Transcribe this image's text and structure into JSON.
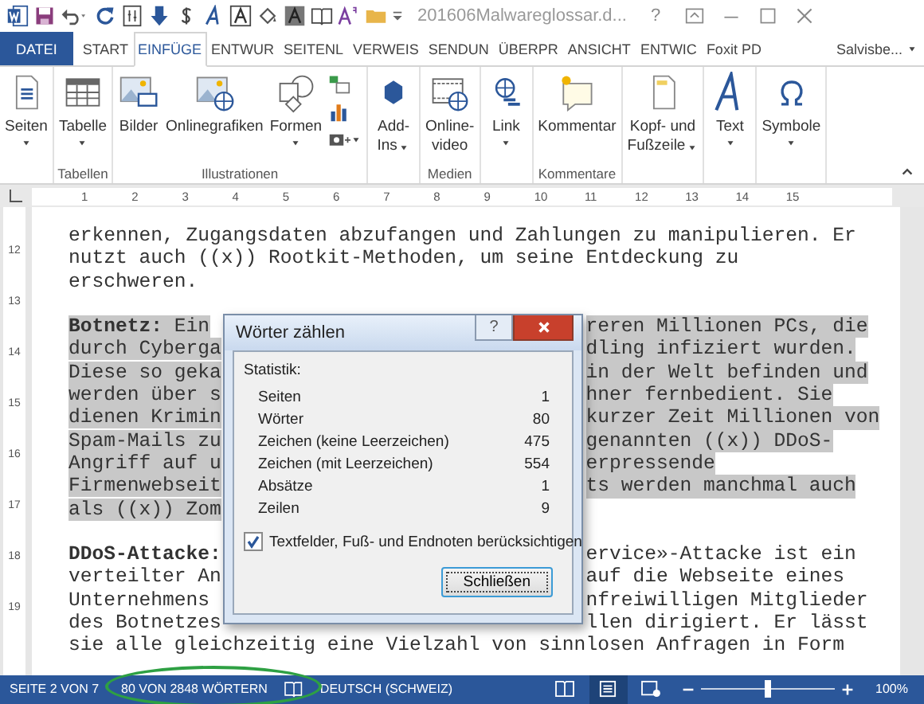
{
  "title_bar": {
    "title": "201606Malwareglossar.d...",
    "help": "?"
  },
  "tabs": [
    {
      "label": "DATEI",
      "kind": "file",
      "selected": false
    },
    {
      "label": "START",
      "kind": "tab",
      "selected": false
    },
    {
      "label": "EINFÜGE",
      "kind": "tab",
      "selected": true
    },
    {
      "label": "ENTWUR",
      "kind": "tab",
      "selected": false
    },
    {
      "label": "SEITENL",
      "kind": "tab",
      "selected": false
    },
    {
      "label": "VERWEIS",
      "kind": "tab",
      "selected": false
    },
    {
      "label": "SENDUN",
      "kind": "tab",
      "selected": false
    },
    {
      "label": "ÜBERPR",
      "kind": "tab",
      "selected": false
    },
    {
      "label": "ANSICHT",
      "kind": "tab",
      "selected": false
    },
    {
      "label": "ENTWIC",
      "kind": "tab",
      "selected": false
    },
    {
      "label": "Foxit PD",
      "kind": "tab",
      "selected": false
    }
  ],
  "account": {
    "name": "Salvisbe..."
  },
  "ribbon": {
    "groups": [
      {
        "buttons": [
          {
            "kind": "large",
            "label_lines": [
              "Seiten"
            ],
            "dropdown": true
          }
        ]
      },
      {
        "label": "Tabellen",
        "buttons": [
          {
            "kind": "large",
            "label_lines": [
              "Tabelle"
            ],
            "dropdown": true
          }
        ]
      },
      {
        "label": "Illustrationen",
        "buttons": [
          {
            "kind": "large",
            "label_lines": [
              "Bilder"
            ],
            "dropdown": false
          },
          {
            "kind": "large",
            "label_lines": [
              "Onlinegrafiken"
            ],
            "dropdown": false
          },
          {
            "kind": "large",
            "label_lines": [
              "Formen"
            ],
            "dropdown": true
          },
          {
            "kind": "small",
            "dropdown": false
          },
          {
            "kind": "small",
            "dropdown": false
          },
          {
            "kind": "small",
            "dropdown": true
          }
        ]
      },
      {
        "buttons": [
          {
            "kind": "large",
            "label_lines": [
              "Add-",
              "Ins"
            ],
            "dropdown": true
          }
        ]
      },
      {
        "label": "Medien",
        "buttons": [
          {
            "kind": "large",
            "label_lines": [
              "Online-",
              "video"
            ],
            "dropdown": false
          }
        ]
      },
      {
        "buttons": [
          {
            "kind": "large",
            "label_lines": [
              "Link"
            ],
            "dropdown": true
          }
        ]
      },
      {
        "label": "Kommentare",
        "buttons": [
          {
            "kind": "large",
            "label_lines": [
              "Kommentar"
            ],
            "dropdown": false
          }
        ]
      },
      {
        "buttons": [
          {
            "kind": "large",
            "label_lines": [
              "Kopf- und",
              "Fußzeile"
            ],
            "dropdown": true
          }
        ]
      },
      {
        "buttons": [
          {
            "kind": "large",
            "label_lines": [
              "Text"
            ],
            "dropdown": true
          }
        ]
      },
      {
        "buttons": [
          {
            "kind": "large",
            "label_lines": [
              "Symbole"
            ],
            "dropdown": true
          }
        ]
      }
    ]
  },
  "ruler": {
    "marks": [
      "1",
      "2",
      "3",
      "4",
      "5",
      "6",
      "7",
      "8",
      "9",
      "10",
      "11",
      "12",
      "13",
      "14",
      "15"
    ]
  },
  "side_ruler": {
    "marks": [
      "12",
      "13",
      "14",
      "15",
      "16",
      "17",
      "18",
      "19"
    ]
  },
  "document": {
    "paragraphs": [
      {
        "selected": false,
        "lines": [
          {
            "text": "erkennen, Zugangsdaten abzufangen und Zahlungen zu manipulieren. Er"
          },
          {
            "text": "nutzt auch ((x)) Rootkit-Methoden, um seine Entdeckung zu"
          },
          {
            "text": "erschweren."
          }
        ]
      },
      {
        "selected": true,
        "lines": [
          {
            "left": "**Botnetz:** Ein",
            "right": "reren Millionen PCs, die"
          },
          {
            "left": "durch Cyberga",
            "right": "dling infiziert wurden."
          },
          {
            "left": "Diese so geka",
            "right": "in der Welt befinden und"
          },
          {
            "left": "werden über s",
            "right": "hner fernbedient. Sie"
          },
          {
            "left": "dienen Krimin",
            "right": "kurzer Zeit Millionen von"
          },
          {
            "left": "Spam-Mails zu",
            "right": "genannten ((x)) DDoS-"
          },
          {
            "left": "Angriff auf u",
            "right": "erpressende"
          },
          {
            "left": "Firmenwebseit",
            "right": "ts werden manchmal auch"
          },
          {
            "left": "als ((x)) Zom"
          }
        ]
      },
      {
        "selected": false,
        "lines": [
          {
            "left": "**DDoS-Attacke:**",
            "right": "ervice»-Attacke ist ein"
          },
          {
            "left": "verteilter An",
            "right": "auf die Webseite eines"
          },
          {
            "left": "Unternehmens",
            "right": "nfreiwilligen Mitglieder"
          },
          {
            "left": "des Botnetzes",
            "right": "llen dirigiert. Er lässt"
          },
          {
            "text": "sie alle gleichzeitig eine Vielzahl von sinnlosen Anfragen in Form"
          }
        ]
      }
    ]
  },
  "dialog": {
    "title": "Wörter zählen",
    "help": "?",
    "group_label": "Statistik:",
    "stats": [
      {
        "label": "Seiten",
        "value": "1"
      },
      {
        "label": "Wörter",
        "value": "80"
      },
      {
        "label": "Zeichen (keine Leerzeichen)",
        "value": "475"
      },
      {
        "label": "Zeichen (mit Leerzeichen)",
        "value": "554"
      },
      {
        "label": "Absätze",
        "value": "1"
      },
      {
        "label": "Zeilen",
        "value": "9"
      }
    ],
    "checkbox": {
      "label": "Textfelder, Fuß- und Endnoten berücksichtigen",
      "checked": true
    },
    "close_button": "Schließen"
  },
  "status_bar": {
    "page": "SEITE 2 VON 7",
    "words": "80 VON 2848 WÖRTERN",
    "language": "DEUTSCH (SCHWEIZ)",
    "views": [
      {
        "selected": false
      },
      {
        "selected": true
      },
      {
        "selected": false
      }
    ],
    "zoom": {
      "level": 0.5,
      "reading": "100%"
    }
  }
}
